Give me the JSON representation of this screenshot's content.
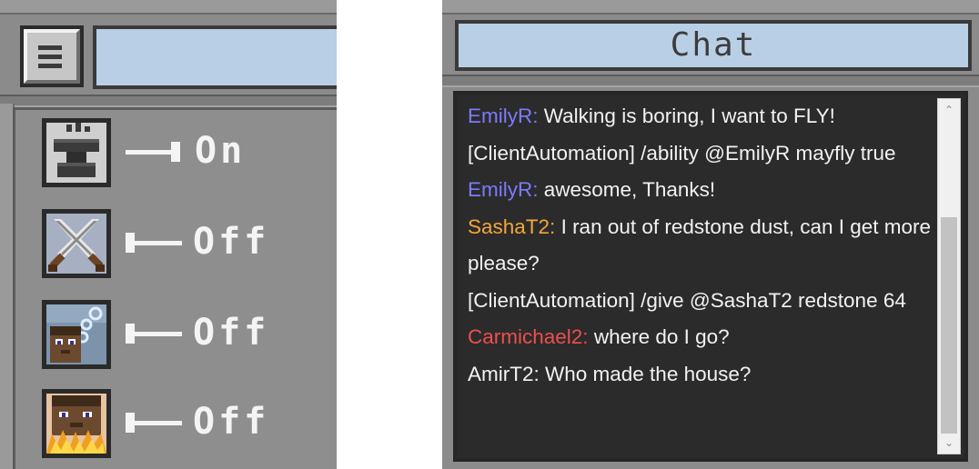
{
  "left": {
    "menu_icon": "hamburger-menu-icon",
    "search_value": "",
    "abilities": [
      {
        "icon": "anvil-icon",
        "state": "On",
        "on": true
      },
      {
        "icon": "crossed-swords-icon",
        "state": "Off",
        "on": false
      },
      {
        "icon": "bubbles-player-icon",
        "state": "Off",
        "on": false
      },
      {
        "icon": "burning-player-icon",
        "state": "Off",
        "on": false
      }
    ]
  },
  "chat": {
    "title": "Chat",
    "messages": [
      {
        "name": "EmilyR:",
        "name_color": "purple",
        "text": " Walking is boring, I want to FLY!"
      },
      {
        "name": "",
        "name_color": "",
        "text": "[ClientAutomation] /ability @EmilyR mayfly true"
      },
      {
        "name": "EmilyR:",
        "name_color": "purple",
        "text": " awesome, Thanks!"
      },
      {
        "name": "SashaT2:",
        "name_color": "orange",
        "text": " I ran out of redstone dust, can I get more please?"
      },
      {
        "name": "",
        "name_color": "",
        "text": "[ClientAutomation] /give @SashaT2 redstone 64"
      },
      {
        "name": "Carmichael2:",
        "name_color": "red",
        "text": " where do I go?"
      },
      {
        "name": "",
        "name_color": "",
        "text": "AmirT2: Who made the house?"
      }
    ],
    "scroll_up_icon": "chevron-up-icon",
    "scroll_down_icon": "chevron-down-icon"
  },
  "colors": {
    "panel_gray": "#8b8b8b",
    "field_blue": "#b8cfe6",
    "chat_bg": "#2b2b2b",
    "name_purple": "#7b7bff",
    "name_orange": "#f3a63a",
    "name_red": "#ef4e4e"
  }
}
